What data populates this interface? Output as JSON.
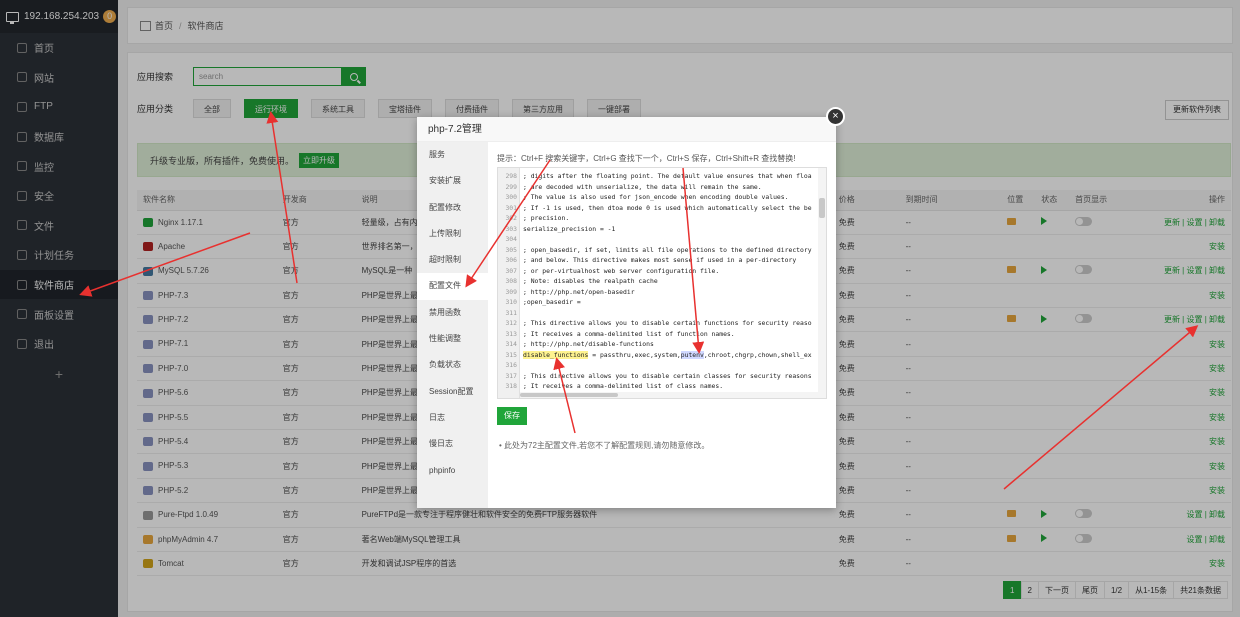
{
  "sidebar": {
    "host": "192.168.254.203",
    "badge": "0",
    "items": [
      {
        "label": "首页",
        "icon": "home-icon"
      },
      {
        "label": "网站",
        "icon": "globe-icon"
      },
      {
        "label": "FTP",
        "icon": "ftp-icon"
      },
      {
        "label": "数据库",
        "icon": "database-icon"
      },
      {
        "label": "监控",
        "icon": "monitor-icon"
      },
      {
        "label": "安全",
        "icon": "shield-icon"
      },
      {
        "label": "文件",
        "icon": "folder-icon"
      },
      {
        "label": "计划任务",
        "icon": "clock-icon"
      },
      {
        "label": "软件商店",
        "icon": "apps-icon"
      },
      {
        "label": "面板设置",
        "icon": "gear-icon"
      },
      {
        "label": "退出",
        "icon": "logout-icon"
      }
    ],
    "add": "+"
  },
  "breadcrumb": {
    "home": "首页",
    "sep": "/",
    "current": "软件商店"
  },
  "search": {
    "label": "应用搜索",
    "placeholder": "search"
  },
  "categories": {
    "label": "应用分类",
    "items": [
      "全部",
      "运行环境",
      "系统工具",
      "宝塔插件",
      "付费插件",
      "第三方应用",
      "一键部署"
    ]
  },
  "update_list": "更新软件列表",
  "promo": {
    "text": "升级专业版，所有插件，免费使用。",
    "button": "立即升级"
  },
  "table": {
    "headers": [
      "软件名称",
      "开发商",
      "说明",
      "价格",
      "到期时间",
      "位置",
      "状态",
      "首页显示",
      "操作"
    ],
    "rows": [
      {
        "name": "Nginx 1.17.1",
        "dev": "官方",
        "desc": "轻量级，占有内",
        "price": "免费",
        "expire": "--",
        "installed": true,
        "ops": "更新 | 设置 | 卸载",
        "color": "#1fa33a"
      },
      {
        "name": "Apache",
        "dev": "官方",
        "desc": "世界排名第一，",
        "price": "免费",
        "expire": "--",
        "installed": false,
        "ops": "安装",
        "color": "#b22222"
      },
      {
        "name": "MySQL 5.7.26",
        "dev": "官方",
        "desc": "MySQL是一种",
        "price": "免费",
        "expire": "--",
        "installed": true,
        "ops": "更新 | 设置 | 卸载",
        "color": "#4479a1"
      },
      {
        "name": "PHP-7.3",
        "dev": "官方",
        "desc": "PHP是世界上最",
        "price": "免费",
        "expire": "--",
        "installed": false,
        "ops": "安装",
        "color": "#8892bf"
      },
      {
        "name": "PHP-7.2",
        "dev": "官方",
        "desc": "PHP是世界上最",
        "price": "免费",
        "expire": "--",
        "installed": true,
        "ops": "更新 | 设置 | 卸载",
        "color": "#8892bf"
      },
      {
        "name": "PHP-7.1",
        "dev": "官方",
        "desc": "PHP是世界上最",
        "price": "免费",
        "expire": "--",
        "installed": false,
        "ops": "安装",
        "color": "#8892bf"
      },
      {
        "name": "PHP-7.0",
        "dev": "官方",
        "desc": "PHP是世界上最",
        "price": "免费",
        "expire": "--",
        "installed": false,
        "ops": "安装",
        "color": "#8892bf"
      },
      {
        "name": "PHP-5.6",
        "dev": "官方",
        "desc": "PHP是世界上最",
        "price": "免费",
        "expire": "--",
        "installed": false,
        "ops": "安装",
        "color": "#8892bf"
      },
      {
        "name": "PHP-5.5",
        "dev": "官方",
        "desc": "PHP是世界上最",
        "price": "免费",
        "expire": "--",
        "installed": false,
        "ops": "安装",
        "color": "#8892bf"
      },
      {
        "name": "PHP-5.4",
        "dev": "官方",
        "desc": "PHP是世界上最",
        "price": "免费",
        "expire": "--",
        "installed": false,
        "ops": "安装",
        "color": "#8892bf"
      },
      {
        "name": "PHP-5.3",
        "dev": "官方",
        "desc": "PHP是世界上最",
        "price": "免费",
        "expire": "--",
        "installed": false,
        "ops": "安装",
        "color": "#8892bf"
      },
      {
        "name": "PHP-5.2",
        "dev": "官方",
        "desc": "PHP是世界上最",
        "price": "免费",
        "expire": "--",
        "installed": false,
        "ops": "安装",
        "color": "#8892bf"
      },
      {
        "name": "Pure-Ftpd 1.0.49",
        "dev": "官方",
        "desc": "PureFTPd是一款专注于程序健壮和软件安全的免费FTP服务器软件",
        "price": "免费",
        "expire": "--",
        "installed": true,
        "ops": "设置 | 卸载",
        "color": "#999999"
      },
      {
        "name": "phpMyAdmin 4.7",
        "dev": "官方",
        "desc": "著名Web端MySQL管理工具",
        "price": "免费",
        "expire": "--",
        "installed": true,
        "ops": "设置 | 卸载",
        "color": "#e8a73e"
      },
      {
        "name": "Tomcat",
        "dev": "官方",
        "desc": "开发和调试JSP程序的首选",
        "price": "免费",
        "expire": "--",
        "installed": false,
        "ops": "安装",
        "color": "#d1a41a"
      }
    ]
  },
  "pager": {
    "pages": [
      "1",
      "2"
    ],
    "next": "下一页",
    "last": "尾页",
    "ratio": "1/2",
    "range": "从1-15条",
    "total": "共21条数据"
  },
  "modal": {
    "title": "php-7.2管理",
    "close": "×",
    "tabs": [
      "服务",
      "安装扩展",
      "配置修改",
      "上传限制",
      "超时限制",
      "配置文件",
      "禁用函数",
      "性能调整",
      "负载状态",
      "Session配置",
      "日志",
      "慢日志",
      "phpinfo"
    ],
    "active_tab": 5,
    "tip": "提示：Ctrl+F 搜索关键字，Ctrl+G 查找下一个，Ctrl+S 保存，Ctrl+Shift+R 查找替换!",
    "editor_lines": [
      {
        "n": "298",
        "t": "; digits after the floating point. The default value ensures that when floa"
      },
      {
        "n": "299",
        "t": "; are decoded with unserialize, the data will remain the same."
      },
      {
        "n": "300",
        "t": "; The value is also used for json_encode when encoding double values."
      },
      {
        "n": "301",
        "t": "; If -1 is used, then dtoa mode 0 is used which automatically select the be"
      },
      {
        "n": "302",
        "t": "; precision."
      },
      {
        "n": "303",
        "t": "serialize_precision = -1"
      },
      {
        "n": "304",
        "t": ""
      },
      {
        "n": "305",
        "t": "; open_basedir, if set, limits all file operations to the defined directory"
      },
      {
        "n": "306",
        "t": "; and below.  This directive makes most sense if used in a per-directory"
      },
      {
        "n": "307",
        "t": "; or per-virtualhost web server configuration file."
      },
      {
        "n": "308",
        "t": "; Note: disables the realpath cache"
      },
      {
        "n": "309",
        "t": "; http://php.net/open-basedir"
      },
      {
        "n": "310",
        "t": ";open_basedir ="
      },
      {
        "n": "311",
        "t": ""
      },
      {
        "n": "312",
        "t": "; This directive allows you to disable certain functions for security reaso"
      },
      {
        "n": "313",
        "t": "; It receives a comma-delimited list of function names."
      },
      {
        "n": "314",
        "t": "; http://php.net/disable-functions"
      },
      {
        "n": "315",
        "key": "disable_functions",
        "mid": " = passthru,exec,system,",
        "hit": "putenv",
        "rest": ",chroot,chgrp,chown,shell_ex"
      },
      {
        "n": "316",
        "t": ""
      },
      {
        "n": "317",
        "t": "; This directive allows you to disable certain classes for security reasons"
      },
      {
        "n": "318",
        "t": "; It receives a comma-delimited list of class names."
      }
    ],
    "save": "保存",
    "note": "此处为72主配置文件,若您不了解配置规则,请勿随意修改。"
  },
  "colors": {
    "accent": "#20a53a",
    "annotation": "#e8312f"
  }
}
